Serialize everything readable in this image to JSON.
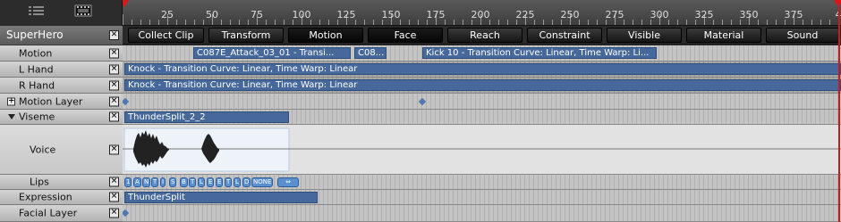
{
  "header": {
    "list_icon": "list-icon",
    "film_icon": "film-strip-icon",
    "ruler_labels": [
      "25",
      "50",
      "75",
      "100",
      "125",
      "150",
      "175",
      "200",
      "225",
      "250",
      "275",
      "300",
      "325",
      "350",
      "375",
      "4"
    ]
  },
  "character": {
    "name": "SuperHero",
    "close": "✕",
    "buttons": [
      "Collect Clip",
      "Transform",
      "Motion",
      "Face",
      "Reach",
      "Constraint",
      "Visible",
      "Material",
      "Sound"
    ]
  },
  "tracks": {
    "motion": {
      "label": "Motion",
      "clips": [
        "C087E_Attack_03_01 - Transi...",
        "C08...",
        "Kick 10 - Transition Curve: Linear, Time Warp: Li..."
      ]
    },
    "l_hand": {
      "label": "L Hand",
      "clip": "Knock - Transition Curve: Linear, Time Warp: Linear"
    },
    "r_hand": {
      "label": "R Hand",
      "clip": "Knock - Transition Curve: Linear, Time Warp: Linear"
    },
    "motion_layer": {
      "label": "Motion Layer",
      "expand": "+"
    },
    "viseme": {
      "label": "Viseme",
      "clip": "ThunderSplit_2_2"
    },
    "voice": {
      "label": "Voice"
    },
    "lips": {
      "label": "Lips",
      "phonemes": [
        "1",
        "A",
        "N",
        "T",
        "I",
        "S",
        "B",
        "T",
        "L",
        "E",
        "E",
        "T",
        "L",
        "D",
        "NONE"
      ],
      "marker": "⇔"
    },
    "expression": {
      "label": "Expression",
      "clip": "ThunderSplit"
    },
    "facial_layer": {
      "label": "Facial Layer"
    }
  }
}
